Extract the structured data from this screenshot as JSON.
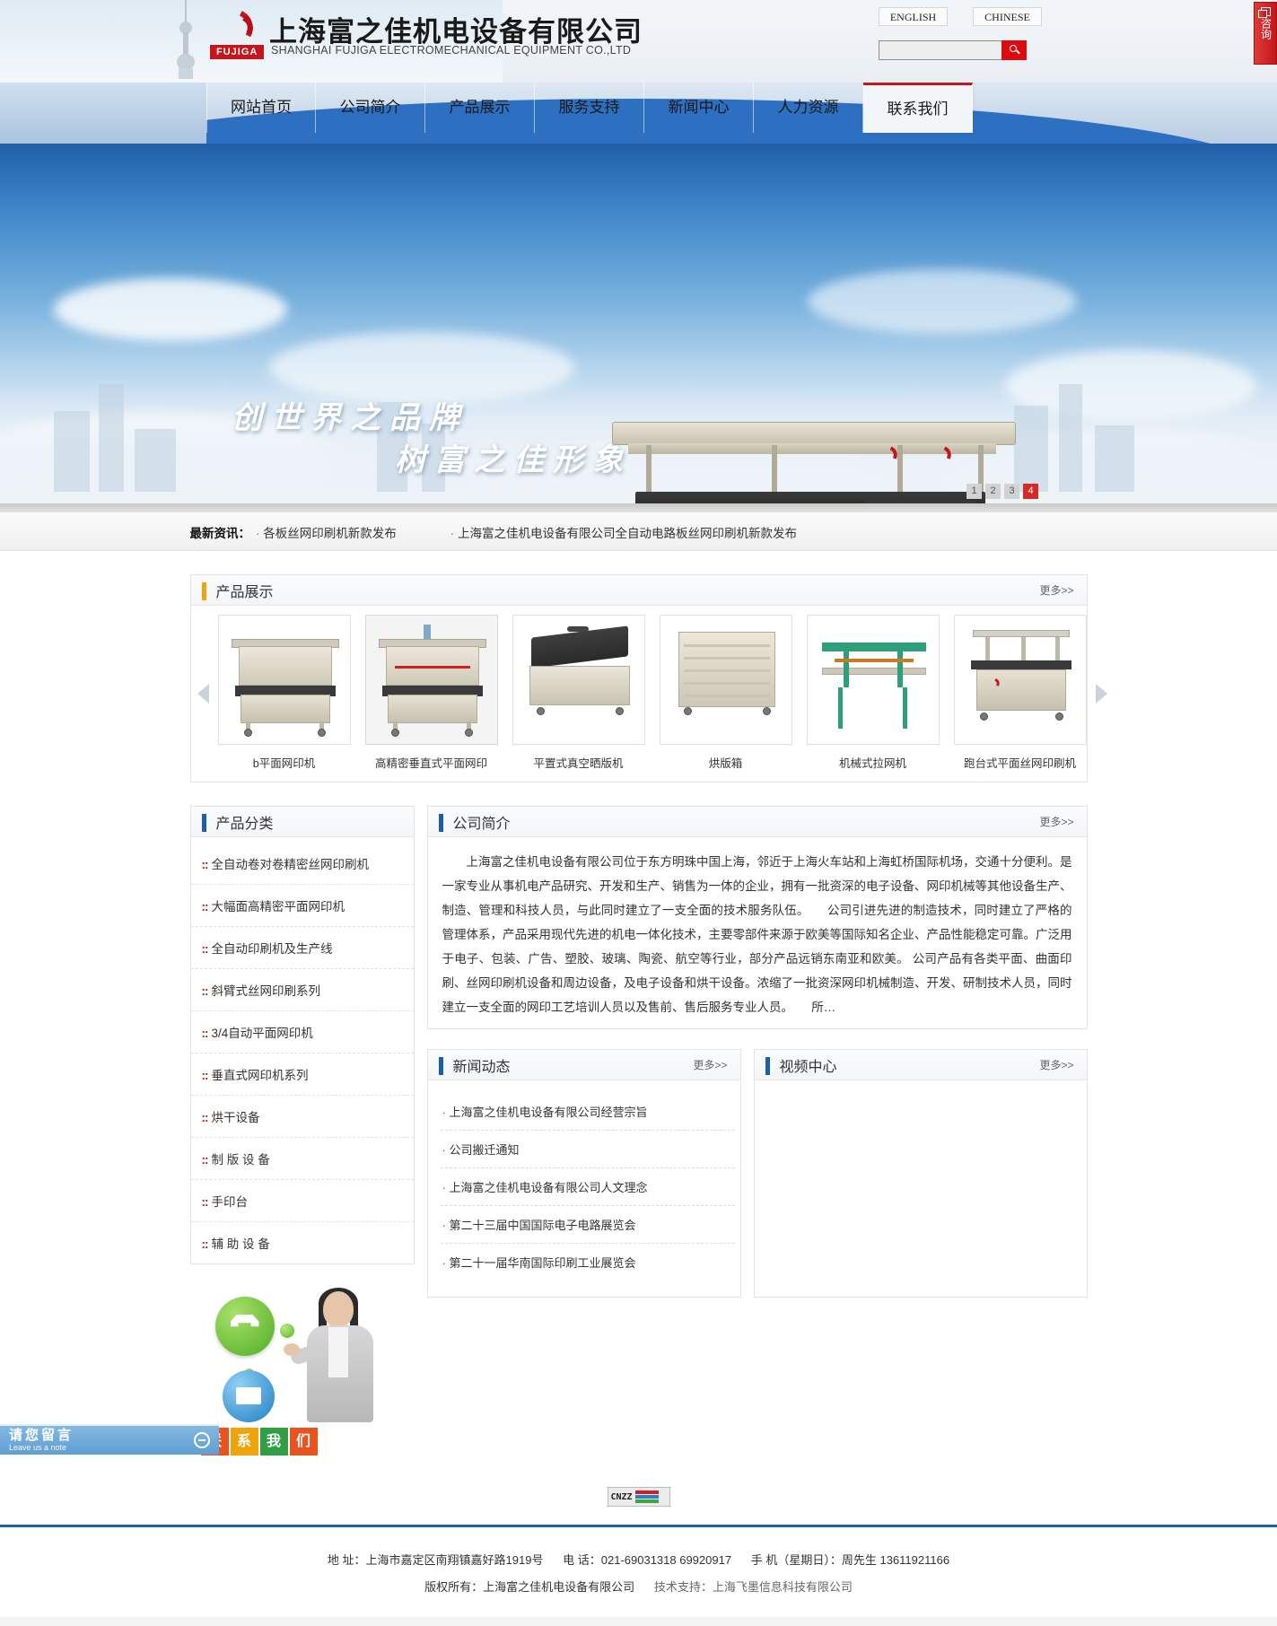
{
  "header": {
    "company_cn": "上海富之佳机电设备有限公司",
    "company_en": "SHANGHAI FUJIGA ELECTROMECHANICAL EQUIPMENT CO.,LTD",
    "logo_badge": "FUJIGA",
    "lang_english": "ENGLISH",
    "lang_chinese": "CHINESE",
    "search_value": "",
    "search_placeholder": "",
    "consult_tab": "咨询"
  },
  "nav": {
    "items": [
      {
        "label": "网站首页",
        "active": false
      },
      {
        "label": "公司简介",
        "active": false
      },
      {
        "label": "产品展示",
        "active": false
      },
      {
        "label": "服务支持",
        "active": false
      },
      {
        "label": "新闻中心",
        "active": false
      },
      {
        "label": "人力资源",
        "active": false
      },
      {
        "label": "联系我们",
        "active": true
      }
    ]
  },
  "banner": {
    "slogan_line1": "创世界之品牌",
    "slogan_line2": "树富之佳形象",
    "slides": [
      "1",
      "2",
      "3",
      "4"
    ],
    "active_slide": "4"
  },
  "ticker": {
    "label": "最新资讯：",
    "items": [
      "各板丝网印刷机新款发布",
      "上海富之佳机电设备有限公司全自动电路板丝网印刷机新款发布"
    ]
  },
  "products": {
    "title": "产品展示",
    "more": "更多>>",
    "prev": "prev-arrow",
    "next": "next-arrow",
    "items": [
      {
        "caption": "b平面网印机"
      },
      {
        "caption": "高精密垂直式平面网印"
      },
      {
        "caption": "平置式真空晒版机"
      },
      {
        "caption": "烘版箱"
      },
      {
        "caption": "机械式拉网机"
      },
      {
        "caption": "跑台式平面丝网印刷机"
      }
    ]
  },
  "categories": {
    "title": "产品分类",
    "items": [
      "全自动卷对卷精密丝网印刷机",
      "大幅面高精密平面网印机",
      "全自动印刷机及生产线",
      "斜臂式丝网印刷系列",
      "3/4自动平面网印机",
      "垂直式网印机系列",
      "烘干设备",
      "制 版 设 备",
      "手印台",
      "辅 助 设 备"
    ]
  },
  "about": {
    "title": "公司简介",
    "more": "更多>>",
    "body": "上海富之佳机电设备有限公司位于东方明珠中国上海，邻近于上海火车站和上海虹桥国际机场，交通十分便利。是一家专业从事机电产品研究、开发和生产、销售为一体的企业，拥有一批资深的电子设备、网印机械等其他设备生产、制造、管理和科技人员，与此同时建立了一支全面的技术服务队伍。　　公司引进先进的制造技术，同时建立了严格的管理体系，产品采用现代先进的机电一体化技术，主要零部件来源于欧美等国际知名企业、产品性能稳定可靠。广泛用于电子、包装、广告、塑胶、玻璃、陶瓷、航空等行业，部分产品远销东南亚和欧美。 公司产品有各类平面、曲面印刷、丝网印刷机设备和周边设备，及电子设备和烘干设备。浓缩了一批资深网印机械制造、开发、研制技术人员，同时建立一支全面的网印工艺培训人员以及售前、售后服务专业人员。　　所…"
  },
  "news": {
    "title": "新闻动态",
    "more": "更多>>",
    "items": [
      "上海富之佳机电设备有限公司经营宗旨",
      "公司搬迁通知",
      "上海富之佳机电设备有限公司人文理念",
      "第二十三届中国国际电子电路展览会",
      "第二十一届华南国际印刷工业展览会"
    ]
  },
  "video": {
    "title": "视频中心",
    "more": "更多>>"
  },
  "promo": {
    "tiles": [
      "联",
      "系",
      "我",
      "们"
    ],
    "tile_colors": [
      "#e8531f",
      "#f0a30a",
      "#2f9e44",
      "#e8531f"
    ]
  },
  "stats": {
    "label": "CNZZ"
  },
  "footer": {
    "address_label": "地 址：",
    "address": "上海市嘉定区南翔镇嘉好路1919号",
    "phone_label": "电 话：",
    "phone": "021-69031318  69920917",
    "mobile_label": "手 机（星期日）：",
    "mobile": "周先生 13611921166",
    "copyright_label": "版权所有：",
    "copyright": "上海富之佳机电设备有限公司",
    "support_label": "技术支持：",
    "support": "上海飞墨信息科技有限公司"
  },
  "notebar": {
    "cn": "请您留言",
    "en": "Leave us a note"
  },
  "colors": {
    "brand_red": "#c4161c",
    "accent_blue": "#1c5fa8",
    "accent_orange": "#f0a30a",
    "footer_rule": "#1466ad"
  }
}
